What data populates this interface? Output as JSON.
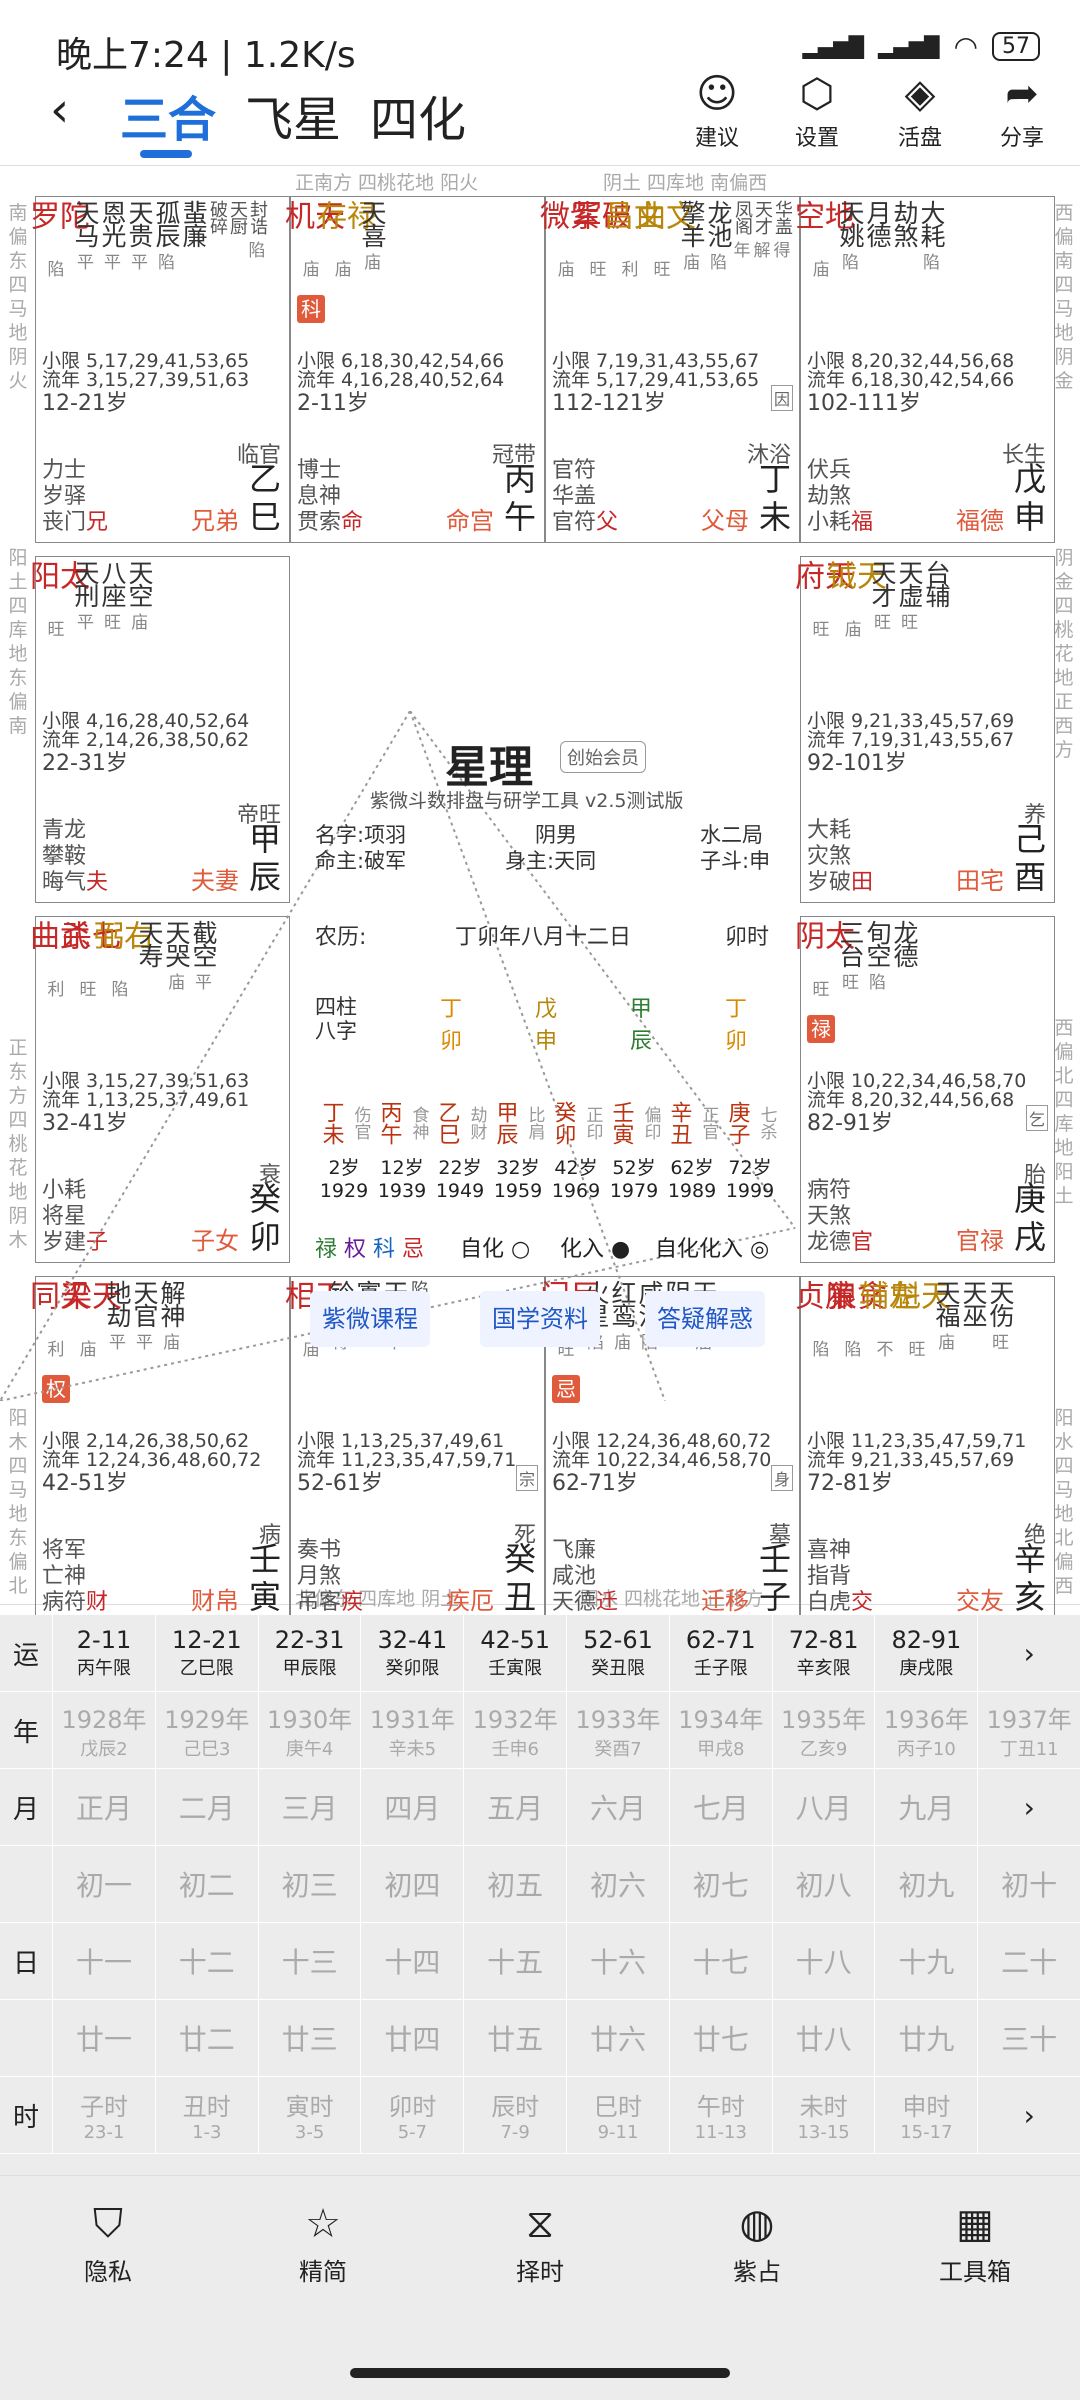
{
  "status": {
    "time": "晚上7:24 | 1.2K/s",
    "battery": "57"
  },
  "nav": {
    "tabs": [
      "三合",
      "飞星",
      "四化"
    ],
    "active": 0,
    "buttons": [
      {
        "label": "建议",
        "icon": "person-voice-icon"
      },
      {
        "label": "设置",
        "icon": "gear-icon"
      },
      {
        "label": "活盘",
        "icon": "cube-icon"
      },
      {
        "label": "分享",
        "icon": "share-icon"
      }
    ]
  },
  "chart_edges": {
    "top_left": "正南方 四桃花地 阳火",
    "top_right": "阴土 四库地 南偏西",
    "bottom_left": "北偏东 四库地 阴土",
    "bottom_right": "阳水 四桃花地 正北方",
    "left_1": "南偏东四马地阴火",
    "left_2": "阳土四库地东偏南",
    "left_3": "正东方四桃花地阴木",
    "left_4": "阳木四马地东偏北",
    "right_1": "西偏南四马地阴金",
    "right_2": "阴金四桃花地正西方",
    "right_3": "西偏北四库地阳土",
    "right_4": "阳水四马地北偏西"
  },
  "cells": [
    {
      "stars": [
        {
          "n": "陀罗",
          "t": "main",
          "b": "陷"
        },
        {
          "n": "天马",
          "t": "minor",
          "b": "平"
        },
        {
          "n": "恩光",
          "t": "minor",
          "b": "平"
        },
        {
          "n": "天贵",
          "t": "minor",
          "b": "平"
        },
        {
          "n": "孤辰",
          "t": "minor",
          "b": "陷"
        },
        {
          "n": "蜚廉",
          "t": "minor"
        },
        {
          "n": "破碎",
          "t": "tiny"
        },
        {
          "n": "天厨",
          "t": "tiny"
        },
        {
          "n": "封诰",
          "t": "tiny",
          "b": "陷"
        }
      ],
      "xiao": "小限 5,17,29,41,53,65",
      "liu": "流年 3,15,27,39,51,63",
      "age": "12-21岁",
      "chang": "临官",
      "gods": [
        "力士",
        "岁驿",
        "丧门"
      ],
      "godw": "兄",
      "palace": "兄弟",
      "gz": "乙巳"
    },
    {
      "stars": [
        {
          "n": "天机",
          "t": "main",
          "b": "庙"
        },
        {
          "n": "禄存",
          "t": "main gold",
          "b": "庙"
        },
        {
          "n": "天喜",
          "t": "minor",
          "b": "庙"
        }
      ],
      "sihua": "科",
      "xiao": "小限 6,18,30,42,54,66",
      "liu": "流年 4,16,28,40,52,64",
      "age": "2-11岁",
      "chang": "冠带",
      "gods": [
        "博士",
        "息神",
        "贯索"
      ],
      "godw": "命",
      "palace": "命宫",
      "gz": "丙午"
    },
    {
      "stars": [
        {
          "n": "紫微",
          "t": "main",
          "b": "庙"
        },
        {
          "n": "破军",
          "t": "main",
          "b": "旺"
        },
        {
          "n": "文昌",
          "t": "main gold",
          "b": "利"
        },
        {
          "n": "文曲",
          "t": "main gold",
          "b": "旺"
        },
        {
          "n": "擎羊",
          "t": "minor",
          "b": "庙"
        },
        {
          "n": "龙池",
          "t": "minor",
          "b": "陷"
        },
        {
          "n": "凤阁",
          "t": "tiny",
          "b": "年"
        },
        {
          "n": "天才",
          "t": "tiny",
          "b": "解"
        },
        {
          "n": "华盖",
          "t": "tiny",
          "b": "得"
        }
      ],
      "xiao": "小限 7,19,31,43,55,67",
      "liu": "流年 5,17,29,41,53,65",
      "age": "112-121岁",
      "chang": "沐浴",
      "gods": [
        "官符",
        "华盖",
        "官符"
      ],
      "godw": "父",
      "palace": "父母",
      "gz": "丁未",
      "tag": "因"
    },
    {
      "stars": [
        {
          "n": "地空",
          "t": "main",
          "b": "庙"
        },
        {
          "n": "天姚",
          "t": "minor",
          "b": "陷"
        },
        {
          "n": "月德",
          "t": "minor"
        },
        {
          "n": "劫煞",
          "t": "minor"
        },
        {
          "n": "大耗",
          "t": "minor",
          "b": "陷"
        }
      ],
      "xiao": "小限 8,20,32,44,56,68",
      "liu": "流年 6,18,30,42,54,66",
      "age": "102-111岁",
      "chang": "长生",
      "gods": [
        "伏兵",
        "劫煞",
        "小耗"
      ],
      "godw": "福",
      "palace": "福德",
      "gz": "戊申"
    },
    {
      "stars": [
        {
          "n": "太阳",
          "t": "main",
          "b": "旺"
        },
        {
          "n": "天刑",
          "t": "minor",
          "b": "平"
        },
        {
          "n": "八座",
          "t": "minor",
          "b": "旺"
        },
        {
          "n": "天空",
          "t": "minor",
          "b": "庙"
        }
      ],
      "xiao": "小限 4,16,28,40,52,64",
      "liu": "流年 2,14,26,38,50,62",
      "age": "22-31岁",
      "chang": "帝旺",
      "gods": [
        "青龙",
        "攀鞍",
        "晦气"
      ],
      "godw": "夫",
      "palace": "夫妻",
      "gz": "甲辰"
    },
    {
      "stars": [
        {
          "n": "天府",
          "t": "main",
          "b": "旺"
        },
        {
          "n": "天钺",
          "t": "main gold",
          "b": "庙"
        },
        {
          "n": "天才",
          "t": "minor",
          "b": "旺"
        },
        {
          "n": "天虚",
          "t": "minor",
          "b": "旺"
        },
        {
          "n": "台辅",
          "t": "minor"
        }
      ],
      "xiao": "小限 9,21,33,45,57,69",
      "liu": "流年 7,19,31,43,55,67",
      "age": "92-101岁",
      "chang": "养",
      "gods": [
        "大耗",
        "灾煞",
        "岁破"
      ],
      "godw": "田",
      "palace": "田宅",
      "gz": "己酉"
    },
    {
      "stars": [
        {
          "n": "武曲",
          "t": "main",
          "b": "利"
        },
        {
          "n": "七杀",
          "t": "main",
          "b": "旺"
        },
        {
          "n": "右弼",
          "t": "main gold",
          "b": "陷"
        },
        {
          "n": "天寿",
          "t": "minor"
        },
        {
          "n": "天哭",
          "t": "minor",
          "b": "庙"
        },
        {
          "n": "截空",
          "t": "minor",
          "b": "平"
        }
      ],
      "xiao": "小限 3,15,27,39,51,63",
      "liu": "流年 1,13,25,37,49,61",
      "age": "32-41岁",
      "chang": "衰",
      "gods": [
        "小耗",
        "将星",
        "岁建"
      ],
      "godw": "子",
      "palace": "子女",
      "gz": "癸卯"
    },
    {
      "stars": [
        {
          "n": "太阴",
          "t": "main",
          "b": "旺"
        },
        {
          "n": "三台",
          "t": "minor",
          "b": "旺"
        },
        {
          "n": "旬空",
          "t": "minor",
          "b": "陷"
        },
        {
          "n": "龙德",
          "t": "minor"
        }
      ],
      "sihua": "禄",
      "xiao": "小限 10,22,34,46,58,70",
      "liu": "流年 8,20,32,44,56,68",
      "age": "82-91岁",
      "chang": "胎",
      "gods": [
        "病符",
        "天煞",
        "龙德"
      ],
      "godw": "官",
      "palace": "官禄",
      "gz": "庚戌",
      "tag": "乞"
    },
    {
      "stars": [
        {
          "n": "天同",
          "t": "main",
          "b": "利"
        },
        {
          "n": "天梁",
          "t": "main",
          "b": "庙"
        },
        {
          "n": "地劫",
          "t": "minor",
          "b": "平"
        },
        {
          "n": "天官",
          "t": "minor",
          "b": "平"
        },
        {
          "n": "解神",
          "t": "minor",
          "b": "庙"
        }
      ],
      "sihua": "权",
      "xiao": "小限 2,14,26,38,50,62",
      "liu": "流年 12,24,36,48,60,72",
      "age": "42-51岁",
      "chang": "病",
      "gods": [
        "将军",
        "亡神",
        "病符"
      ],
      "godw": "财",
      "palace": "财帛",
      "gz": "壬寅"
    },
    {
      "stars": [
        {
          "n": "天相",
          "t": "main",
          "b": "庙"
        },
        {
          "n": "铃星",
          "t": "minor",
          "b": "得"
        },
        {
          "n": "寡宿",
          "t": "minor"
        },
        {
          "n": "天使",
          "t": "minor",
          "b": "平"
        },
        {
          "n": "陷",
          "t": "tiny"
        }
      ],
      "xiao": "小限 1,13,25,37,49,61",
      "liu": "流年 11,23,35,47,59,71",
      "age": "52-61岁",
      "chang": "死",
      "gods": [
        "奏书",
        "月煞",
        "吊客"
      ],
      "godw": "疾",
      "palace": "疾厄",
      "gz": "癸丑",
      "tag": "宗"
    },
    {
      "stars": [
        {
          "n": "巨门",
          "t": "main",
          "b": "旺"
        },
        {
          "n": "火星",
          "t": "minor",
          "b": "陷"
        },
        {
          "n": "红鸾",
          "t": "minor",
          "b": "庙"
        },
        {
          "n": "咸池",
          "t": "minor",
          "b": "陷"
        },
        {
          "n": "阴煞",
          "t": "minor"
        },
        {
          "n": "天德",
          "t": "minor",
          "b": "庙"
        }
      ],
      "sihua": "忌",
      "xiao": "小限 12,24,36,48,60,72",
      "liu": "流年 10,22,34,46,58,70",
      "age": "62-71岁",
      "chang": "墓",
      "gods": [
        "飞廉",
        "咸池",
        "天德"
      ],
      "godw": "迁",
      "palace": "迁移",
      "gz": "壬子",
      "tag": "身"
    },
    {
      "stars": [
        {
          "n": "廉贞",
          "t": "main",
          "b": "陷"
        },
        {
          "n": "贪狼",
          "t": "main",
          "b": "陷"
        },
        {
          "n": "左辅",
          "t": "main gold",
          "b": "不"
        },
        {
          "n": "天魁",
          "t": "main gold",
          "b": "旺"
        },
        {
          "n": "天福",
          "t": "minor",
          "b": "庙"
        },
        {
          "n": "天巫",
          "t": "minor"
        },
        {
          "n": "天伤",
          "t": "minor",
          "b": "旺"
        }
      ],
      "xiao": "小限 11,23,35,47,59,71",
      "liu": "流年 9,21,33,45,57,69",
      "age": "72-81岁",
      "chang": "绝",
      "gods": [
        "喜神",
        "指背",
        "白虎"
      ],
      "godw": "交",
      "palace": "交友",
      "gz": "辛亥"
    }
  ],
  "center": {
    "title": "星理",
    "badge": "创始会员",
    "subtitle": "紫微斗数排盘与研学工具 v2.5测试版",
    "name": "名字:项羽",
    "gender": "阴男",
    "ju": "水二局",
    "ming": "命主:破军",
    "shen": "身主:天同",
    "zidou": "子斗:申",
    "lunar_label": "农历:",
    "lunar": "丁卯年八月十二日",
    "hour": "卯时",
    "sizhu_label": "四柱",
    "bazi_label": "八字",
    "pillars": [
      {
        "a": "丁",
        "b": "卯",
        "c": "#d98a00"
      },
      {
        "a": "戊",
        "b": "申",
        "c": "#b8860b"
      },
      {
        "a": "甲",
        "b": "辰",
        "c": "#2e7d32"
      },
      {
        "a": "丁",
        "b": "卯",
        "c": "#d98a00"
      }
    ],
    "dayun": [
      {
        "g": "丁未",
        "s": "伤官",
        "a": "2岁",
        "y": "1929"
      },
      {
        "g": "丙午",
        "s": "食神",
        "a": "12岁",
        "y": "1939"
      },
      {
        "g": "乙巳",
        "s": "劫财",
        "a": "22岁",
        "y": "1949"
      },
      {
        "g": "甲辰",
        "s": "比肩",
        "a": "32岁",
        "y": "1959"
      },
      {
        "g": "癸卯",
        "s": "正印",
        "a": "42岁",
        "y": "1969"
      },
      {
        "g": "壬寅",
        "s": "偏印",
        "a": "52岁",
        "y": "1979"
      },
      {
        "g": "辛丑",
        "s": "正官",
        "a": "62岁",
        "y": "1989"
      },
      {
        "g": "庚子",
        "s": "七杀",
        "a": "72岁",
        "y": "1999"
      }
    ],
    "sihua_legend": [
      "禄",
      "权",
      "科",
      "忌"
    ],
    "zihua": "自化",
    "huaru": "化入",
    "zihuahuaru": "自化化入",
    "buttons": [
      "紫微课程",
      "国学资料",
      "答疑解惑"
    ]
  },
  "bottom": {
    "yun_label": "运",
    "years_label": "年",
    "month_label": "月",
    "day_label": "日",
    "hour_label": "时",
    "yun": [
      [
        "2-11",
        "丙午限"
      ],
      [
        "12-21",
        "乙巳限"
      ],
      [
        "22-31",
        "甲辰限"
      ],
      [
        "32-41",
        "癸卯限"
      ],
      [
        "42-51",
        "壬寅限"
      ],
      [
        "52-61",
        "癸丑限"
      ],
      [
        "62-71",
        "壬子限"
      ],
      [
        "72-81",
        "辛亥限"
      ],
      [
        "82-91",
        "庚戌限"
      ]
    ],
    "years": [
      [
        "1928年",
        "戊辰2"
      ],
      [
        "1929年",
        "己巳3"
      ],
      [
        "1930年",
        "庚午4"
      ],
      [
        "1931年",
        "辛未5"
      ],
      [
        "1932年",
        "壬申6"
      ],
      [
        "1933年",
        "癸酉7"
      ],
      [
        "1934年",
        "甲戌8"
      ],
      [
        "1935年",
        "乙亥9"
      ],
      [
        "1936年",
        "丙子10"
      ],
      [
        "1937年",
        "丁丑11"
      ]
    ],
    "months": [
      "正月",
      "二月",
      "三月",
      "四月",
      "五月",
      "六月",
      "七月",
      "八月",
      "九月"
    ],
    "days1": [
      "初一",
      "初二",
      "初三",
      "初四",
      "初五",
      "初六",
      "初七",
      "初八",
      "初九",
      "初十"
    ],
    "days2": [
      "十一",
      "十二",
      "十三",
      "十四",
      "十五",
      "十六",
      "十七",
      "十八",
      "十九",
      "二十"
    ],
    "days3": [
      "廿一",
      "廿二",
      "廿三",
      "廿四",
      "廿五",
      "廿六",
      "廿七",
      "廿八",
      "廿九",
      "三十"
    ],
    "hours": [
      [
        "子时",
        "23-1"
      ],
      [
        "丑时",
        "1-3"
      ],
      [
        "寅时",
        "3-5"
      ],
      [
        "卯时",
        "5-7"
      ],
      [
        "辰时",
        "7-9"
      ],
      [
        "巳时",
        "9-11"
      ],
      [
        "午时",
        "11-13"
      ],
      [
        "未时",
        "13-15"
      ],
      [
        "申时",
        "15-17"
      ]
    ]
  },
  "tabbar": [
    {
      "label": "隐私",
      "icon": "shield-check-icon"
    },
    {
      "label": "精简",
      "icon": "star-icon"
    },
    {
      "label": "择时",
      "icon": "hourglass-icon"
    },
    {
      "label": "紫占",
      "icon": "globe-icon"
    },
    {
      "label": "工具箱",
      "icon": "grid-icon"
    }
  ]
}
